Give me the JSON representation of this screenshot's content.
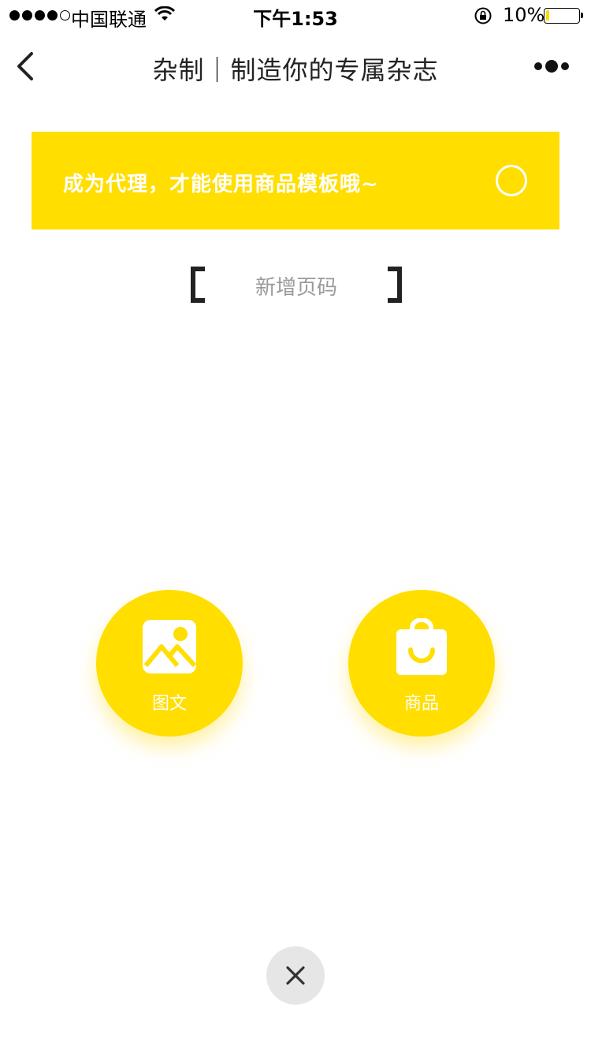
{
  "status_bar": {
    "carrier": "中国联通",
    "time": "下午1:53",
    "battery": "10%",
    "battery_level": 0.1
  },
  "nav": {
    "title": "杂制｜制造你的专属杂志",
    "back_icon": "chevron-left-icon",
    "more_icon": "more-dots-icon"
  },
  "notice": {
    "text": "成为代理，才能使用商品模板哦~",
    "selected": false
  },
  "add_page": {
    "label": "新增页码"
  },
  "actions": [
    {
      "label": "图文",
      "icon": "image-icon"
    },
    {
      "label": "商品",
      "icon": "shopping-bag-icon"
    }
  ],
  "close": {
    "icon": "close-icon"
  },
  "colors": {
    "accent": "#ffde00",
    "close_bg": "#e6e6e6",
    "muted_text": "#9a9a9a"
  }
}
